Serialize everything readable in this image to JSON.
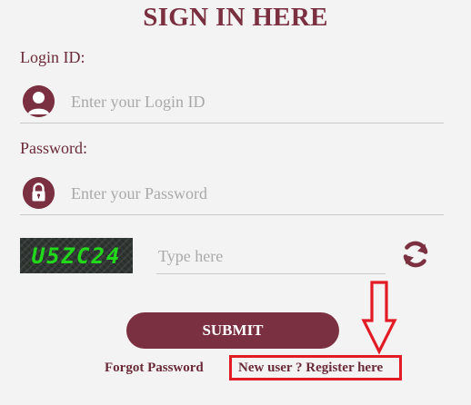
{
  "form": {
    "title": "SIGN IN HERE",
    "login": {
      "label": "Login ID:",
      "placeholder": "Enter your Login ID",
      "icon": "user-avatar-icon"
    },
    "password": {
      "label": "Password:",
      "placeholder": "Enter your Password",
      "icon": "lock-icon"
    },
    "captcha": {
      "code": "U5ZC24",
      "placeholder": "Type here",
      "refresh_icon": "refresh-icon"
    },
    "submit_label": "SUBMIT",
    "forgot_label": "Forgot Password",
    "register_label": "New user ? Register here"
  },
  "colors": {
    "brand": "#7a3040",
    "annotation": "#e21c24",
    "captcha_text": "#22d81a"
  }
}
